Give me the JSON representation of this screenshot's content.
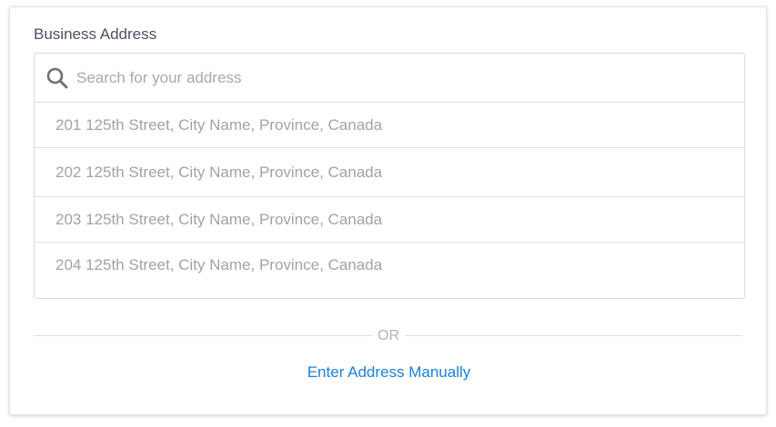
{
  "form": {
    "label": "Business Address",
    "search": {
      "placeholder": "Search for your address",
      "value": "",
      "icon": "search-icon"
    },
    "results": [
      "201 125th Street, City Name, Province, Canada",
      "202 125th Street, City Name, Province, Canada",
      "203 125th Street, City Name, Province, Canada",
      "204 125th Street, City Name, Province, Canada"
    ],
    "divider_text": "OR",
    "manual_link": "Enter Address Manually"
  },
  "colors": {
    "label": "#4a5360",
    "placeholder": "#a9a9a9",
    "result_text": "#a3a3a3",
    "link": "#1e7fd6",
    "border": "#dcdcdc"
  }
}
